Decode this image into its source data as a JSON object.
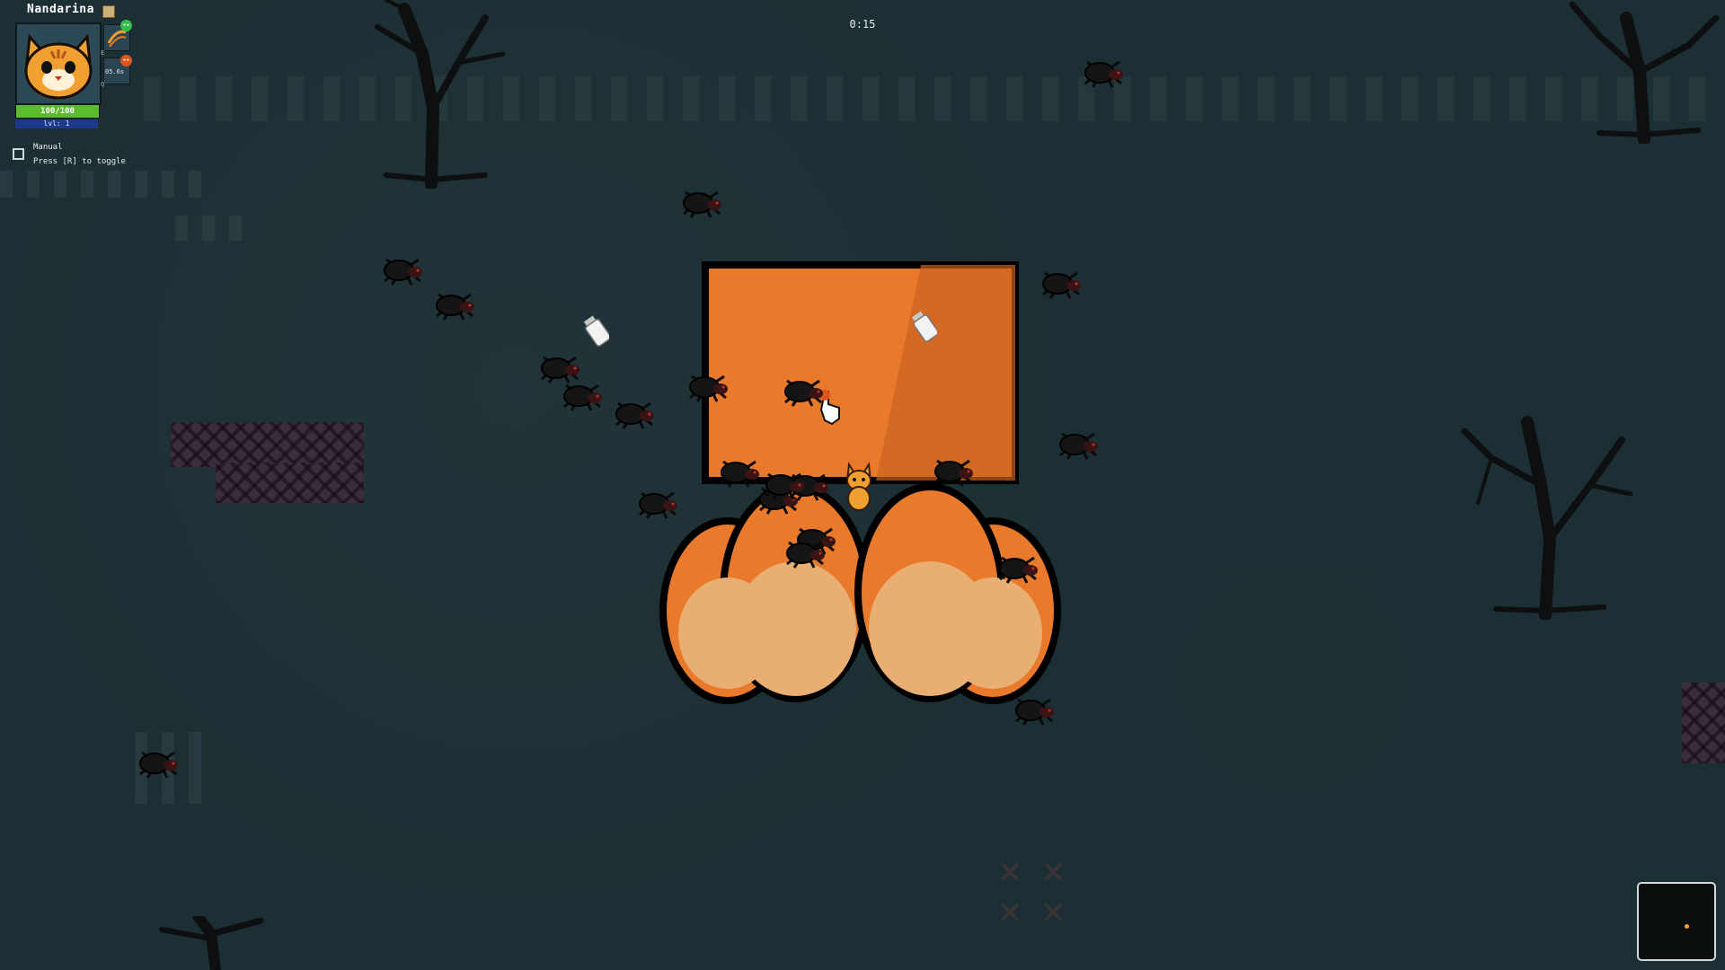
{
  "hud": {
    "player_name": "Nandarina",
    "hp_text": "100/100",
    "hp_fraction": 1.0,
    "level_text": "lvl: 1",
    "abilities": [
      {
        "icon": "claw-swipe-icon",
        "key": "E",
        "badge": "••",
        "badge_color": "#2fbf4a"
      },
      {
        "icon": "ability-slot-icon",
        "key": "Q",
        "badge": "••",
        "badge_color": "#e0561a",
        "value": "05.6s"
      }
    ],
    "manual_label": "Manual",
    "manual_hint": "Press [R] to toggle",
    "manual_checked": false
  },
  "timer": "0:15",
  "colors": {
    "background": "#1c2f34",
    "paw_orange": "#e97a2b",
    "paw_pad": "#e8ae72",
    "hp_green": "#5bbd2e",
    "level_blue": "#1e3a8a",
    "minimap_player": "#f0a030"
  },
  "entities": {
    "player": "orange-cat",
    "boss": "giant-cat-paw",
    "enemies": "black-spider",
    "pickups": "milk-bottle"
  }
}
